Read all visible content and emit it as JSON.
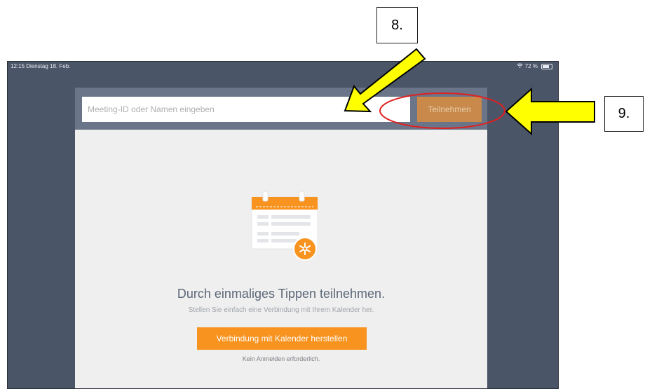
{
  "status_bar": {
    "time_date": "12:15  Dienstag 18. Feb.",
    "battery_text": "72 %",
    "battery_level": 0.72
  },
  "search": {
    "placeholder": "Meeting-ID oder Namen eingeben",
    "join_label": "Teilnehmen"
  },
  "empty_state": {
    "title": "Durch einmaliges Tippen teilnehmen.",
    "subtitle": "Stellen Sie einfach eine Verbindung mit Ihrem Kalender her.",
    "connect_label": "Verbindung mit Kalender herstellen",
    "note": "Kein Anmelden erforderlich."
  },
  "annotations": {
    "step8": "8.",
    "step9": "9."
  },
  "icons": [
    "wifi-icon",
    "battery-icon",
    "calendar-illustration-icon",
    "asterisk-badge-icon",
    "arrow-annotation-icon"
  ],
  "colors": {
    "background": "#4b5568",
    "panel": "#efefef",
    "accent": "#f7931e",
    "join_button": "#c8894a",
    "arrow": "#ffff00",
    "circle": "#e02020"
  }
}
